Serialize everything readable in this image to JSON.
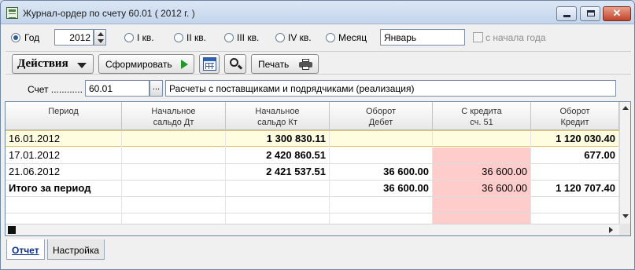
{
  "window": {
    "title": "Журнал-ордер по счету 60.01 ( 2012 г. )"
  },
  "period": {
    "options": [
      {
        "label": "Год",
        "checked": true
      },
      {
        "label": "I кв.",
        "checked": false
      },
      {
        "label": "II кв.",
        "checked": false
      },
      {
        "label": "III кв.",
        "checked": false
      },
      {
        "label": "IV кв.",
        "checked": false
      },
      {
        "label": "Месяц",
        "checked": false
      }
    ],
    "year": "2012",
    "month": "Январь",
    "from_year_start_label": "с начала года"
  },
  "toolbar": {
    "actions_label": "Действия",
    "form_label": "Сформировать",
    "print_label": "Печать"
  },
  "account": {
    "label": "Счет ............",
    "code": "60.01",
    "browse": "...",
    "name": "Расчеты с поставщиками и подрядчиками (реализация)"
  },
  "table": {
    "columns": [
      "Период",
      "Начальное\nсальдо Дт",
      "Начальное\nсальдо Кт",
      "Оборот\nДебет",
      "С кредита\nсч. 51",
      "Оборот\nКредит"
    ],
    "rows": [
      [
        "16.01.2012",
        "",
        "1 300 830.11",
        "",
        "",
        "1 120 030.40"
      ],
      [
        "17.01.2012",
        "",
        "2 420 860.51",
        "",
        "",
        "677.00"
      ],
      [
        "21.06.2012",
        "",
        "2 421 537.51",
        "36 600.00",
        "36 600.00",
        ""
      ],
      [
        "Итого за период",
        "",
        "",
        "36 600.00",
        "36 600.00",
        "1 120 707.40"
      ]
    ]
  },
  "tabs": [
    "Отчет",
    "Настройка"
  ]
}
